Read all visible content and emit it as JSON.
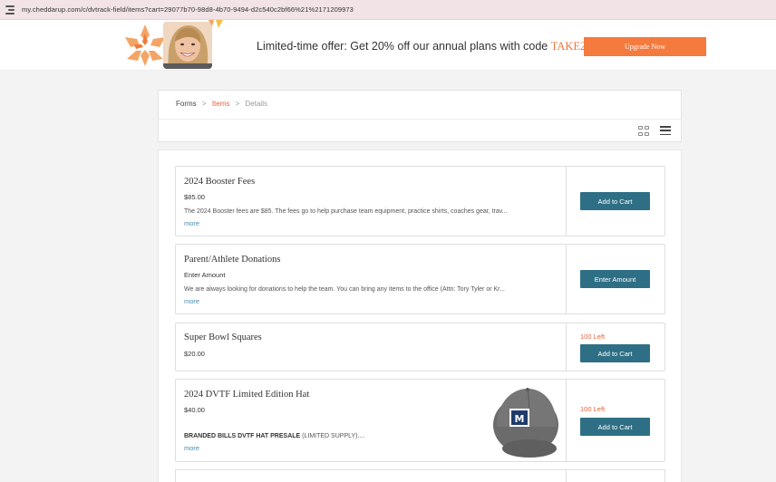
{
  "browser": {
    "url": "my.cheddarup.com/c/dvtrack-field/items?cart=29077b70-98d8-4b70-9494-d2c540c2bf66%21%2171209973"
  },
  "promo": {
    "offer_text": "Limited-time offer: Get 20% off our annual plans with code ",
    "code": "TAKE20",
    "upgrade_label": "Upgrade Now",
    "accent": "#f47a3e"
  },
  "breadcrumb": {
    "forms": "Forms",
    "sep": ">",
    "items": "Items",
    "details": "Details"
  },
  "view_toggle": {
    "grid_icon": "grid-view-icon",
    "list_icon": "list-view-icon"
  },
  "items": [
    {
      "title": "2024 Booster Fees",
      "price": "$85.00",
      "description": "The 2024 Booster fees are $85.  The fees go to help purchase team equipment, practice shirts, coaches gear, trav...",
      "more": "more",
      "button": "Add to Cart"
    },
    {
      "title": "Parent/Athlete Donations",
      "price": "Enter Amount",
      "description": "We are always looking for donations to help the team. You can bring any items to the office (Attn: Tory Tyler or Kr...",
      "more": "more",
      "button": "Enter Amount"
    },
    {
      "title": "Super Bowl Squares",
      "price": "$20.00",
      "remaining": "100 Left",
      "button": "Add to Cart"
    },
    {
      "title": "2024 DVTF Limited Edition Hat",
      "price": "$40.00",
      "description_bold": "BRANDED BILLS DVTF HAT PRESALE",
      "description": " (LIMITED SUPPLY)....",
      "more": "more",
      "remaining": "100 Left",
      "button": "Add to Cart"
    }
  ],
  "colors": {
    "primary_button": "#2e6f85",
    "link": "#4b8bb1",
    "remaining": "#e8633a"
  }
}
